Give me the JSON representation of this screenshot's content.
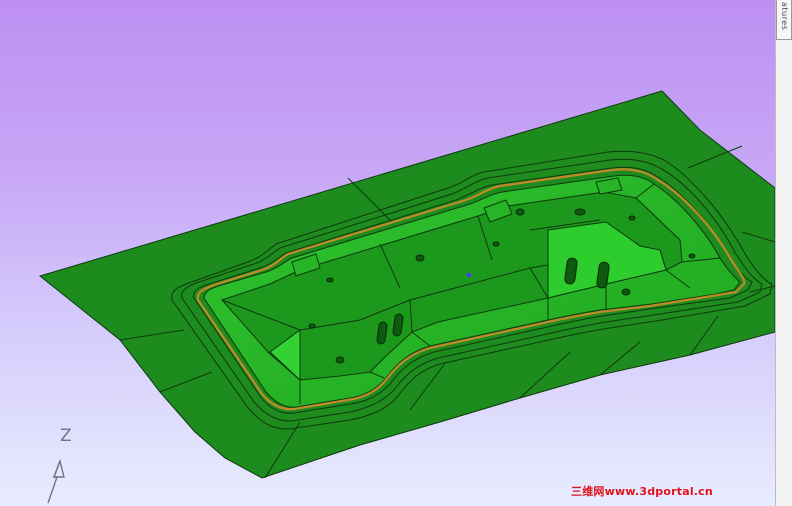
{
  "panel": {
    "tab_label": "atures"
  },
  "viewport": {
    "axis_label": "Z",
    "background_top": "#bd8ff2",
    "background_bottom": "#e8ecff",
    "model_color": "#1f8a1f",
    "part_color": "#23b623",
    "trim_line_color": "#c08a2a"
  },
  "watermark": {
    "text": "三维网www.3dportal.cn"
  },
  "icons": {
    "triad": "axis-triad-icon"
  }
}
